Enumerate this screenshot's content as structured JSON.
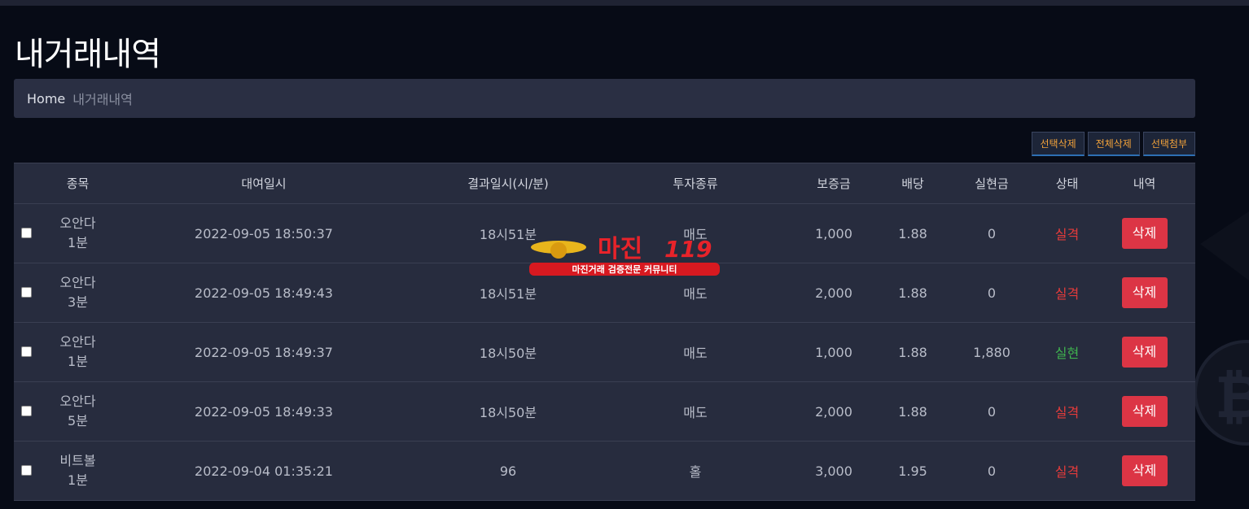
{
  "page": {
    "title": "내거래내역"
  },
  "breadcrumb": {
    "home": "Home",
    "current": "내거래내역"
  },
  "actions": {
    "delete_selected": "선택삭제",
    "delete_all": "전체삭제",
    "attach_selected": "선택첨부"
  },
  "table": {
    "headers": {
      "symbol": "종목",
      "date": "대여일시",
      "result_time": "결과일시(시/분)",
      "type": "투자종류",
      "deposit": "보증금",
      "odds": "배당",
      "payout": "실현금",
      "status": "상태",
      "detail": "내역"
    },
    "rows": [
      {
        "symbol": "오안다",
        "interval": "1분",
        "date": "2022-09-05 18:50:37",
        "result_time": "18시51분",
        "type": "매도",
        "deposit": "1,000",
        "odds": "1.88",
        "payout": "0",
        "status": "실격",
        "status_kind": "lose",
        "delete": "삭제"
      },
      {
        "symbol": "오안다",
        "interval": "3분",
        "date": "2022-09-05 18:49:43",
        "result_time": "18시51분",
        "type": "매도",
        "deposit": "2,000",
        "odds": "1.88",
        "payout": "0",
        "status": "실격",
        "status_kind": "lose",
        "delete": "삭제"
      },
      {
        "symbol": "오안다",
        "interval": "1분",
        "date": "2022-09-05 18:49:37",
        "result_time": "18시50분",
        "type": "매도",
        "deposit": "1,000",
        "odds": "1.88",
        "payout": "1,880",
        "status": "실현",
        "status_kind": "win",
        "delete": "삭제"
      },
      {
        "symbol": "오안다",
        "interval": "5분",
        "date": "2022-09-05 18:49:33",
        "result_time": "18시50분",
        "type": "매도",
        "deposit": "2,000",
        "odds": "1.88",
        "payout": "0",
        "status": "실격",
        "status_kind": "lose",
        "delete": "삭제"
      },
      {
        "symbol": "비트볼",
        "interval": "1분",
        "date": "2022-09-04 01:35:21",
        "result_time": "96",
        "type": "홀",
        "deposit": "3,000",
        "odds": "1.95",
        "payout": "0",
        "status": "실격",
        "status_kind": "lose",
        "delete": "삭제"
      }
    ]
  },
  "watermark": {
    "logo_text": "마진",
    "tagline": "마진거래 검증전문 커뮤니티"
  },
  "colors": {
    "lose": "#e53b3b",
    "win": "#3fb34f",
    "delete_button": "#dc3545",
    "action_text": "#f2a23a"
  }
}
